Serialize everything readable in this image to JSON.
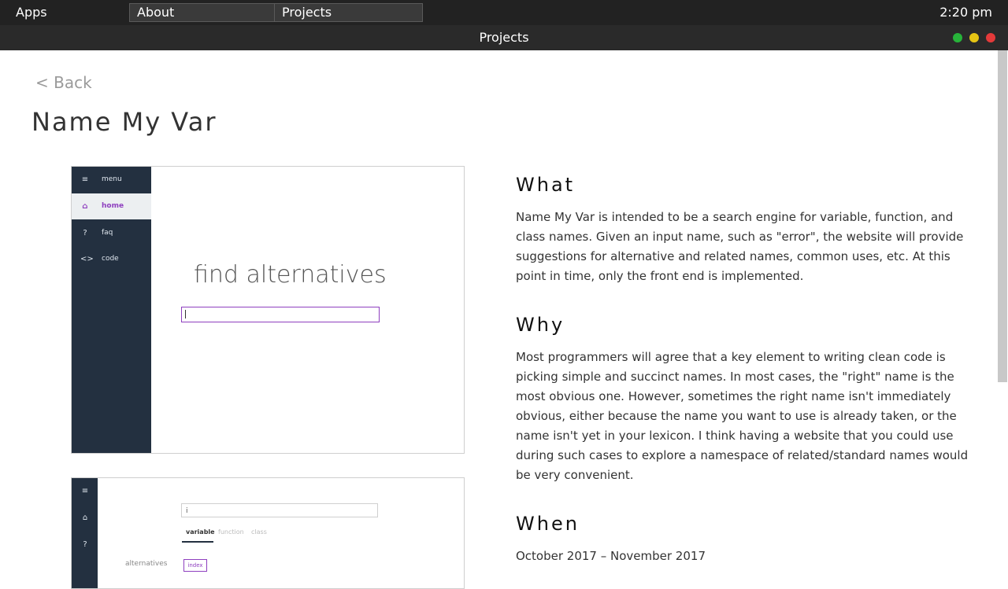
{
  "topbar": {
    "apps_label": "Apps",
    "tabs": [
      {
        "label": "About"
      },
      {
        "label": "Projects"
      }
    ],
    "clock": "2:20 pm"
  },
  "window": {
    "title": "Projects",
    "controls": [
      "green",
      "yellow",
      "red"
    ]
  },
  "page": {
    "back_label": "< Back",
    "title": "Name My Var"
  },
  "screenshot1": {
    "sidebar": [
      {
        "icon": "menu-icon",
        "label": "menu"
      },
      {
        "icon": "home-icon",
        "label": "home"
      },
      {
        "icon": "help-icon",
        "label": "faq"
      },
      {
        "icon": "code-icon",
        "label": "code"
      }
    ],
    "heading": "find alternatives"
  },
  "screenshot2": {
    "input_value": "i",
    "tabs": [
      "variable",
      "function",
      "class"
    ],
    "alternatives_label": "alternatives",
    "chip": "index"
  },
  "sections": {
    "what": {
      "title": "What",
      "body": "Name My Var is intended to be a search engine for variable, function, and class names. Given an input name, such as \"error\", the website will provide suggestions for alternative and related names, common uses, etc. At this point in time, only the front end is implemented."
    },
    "why": {
      "title": "Why",
      "body": "Most programmers will agree that a key element to writing clean code is picking simple and succinct names. In most cases, the \"right\" name is the most obvious one. However, sometimes the right name isn't immediately obvious, either because the name you want to use is already taken, or the name isn't yet in your lexicon. I think having a website that you could use during such cases to explore a namespace of related/standard names would be very convenient."
    },
    "when": {
      "title": "When",
      "body": "October 2017 – November 2017"
    }
  }
}
